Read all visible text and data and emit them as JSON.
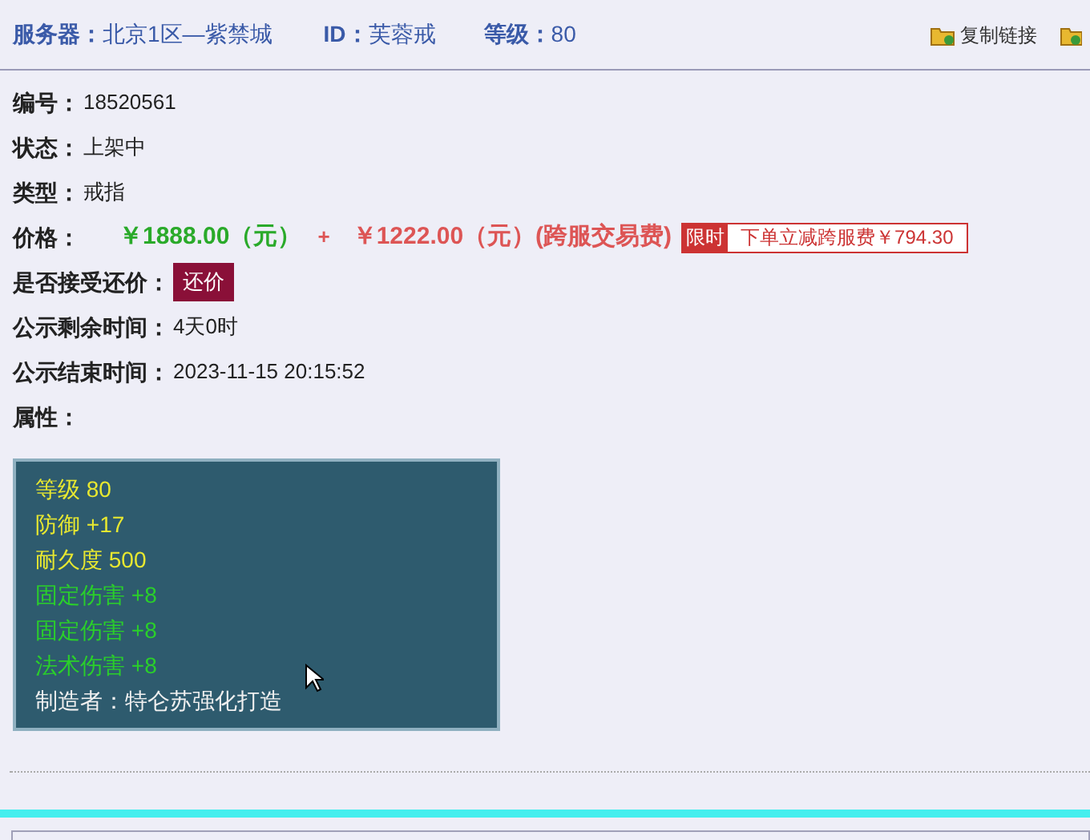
{
  "header": {
    "server_label": "服务器：",
    "server": "北京1区—紫禁城",
    "id_label": "ID：",
    "id": "芙蓉戒",
    "level_label": "等级：",
    "level_value": "80",
    "copy_link": "复制链接"
  },
  "fields": [
    {
      "kind": "text",
      "label": "编号：",
      "value": "18520561"
    },
    {
      "kind": "text",
      "label": "状态：",
      "value": "上架中"
    },
    {
      "kind": "text",
      "label": "类型：",
      "value": "戒指"
    },
    {
      "kind": "price",
      "label": "价格：",
      "price": "￥1888.00（元）",
      "plus": "+",
      "fee": "￥1222.00（元）(跨服交易费)",
      "promo_tag": "限时",
      "promo_text": "下单立减跨服费￥794.30"
    },
    {
      "kind": "button",
      "label": "是否接受还价：",
      "button": "还价"
    },
    {
      "kind": "text",
      "label": "公示剩余时间：",
      "value": "4天0时"
    },
    {
      "kind": "text",
      "label": "公示结束时间：",
      "value": "2023-11-15 20:15:52"
    },
    {
      "kind": "text",
      "label": "属性："
    }
  ],
  "attributes": [
    {
      "text": "等级 80",
      "color": "#e8e830"
    },
    {
      "text": "防御 +17",
      "color": "#e8e830"
    },
    {
      "text": "耐久度 500",
      "color": "#e8e830"
    },
    {
      "text": "固定伤害 +8",
      "color": "#2ad02a"
    },
    {
      "text": "固定伤害 +8",
      "color": "#2ad02a"
    },
    {
      "text": "法术伤害 +8",
      "color": "#2ad02a"
    },
    {
      "text": "制造者：特仑苏强化打造",
      "color": "#f0f0f0"
    }
  ]
}
